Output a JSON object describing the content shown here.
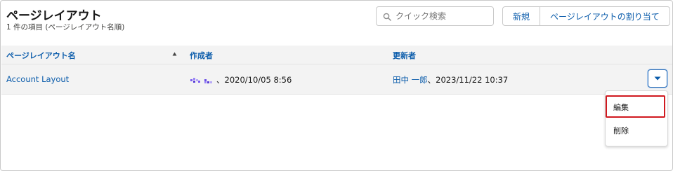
{
  "header": {
    "title": "ページレイアウト",
    "subtitle": "1 件の項目 (ページレイアウト名順)"
  },
  "search": {
    "placeholder": "クイック検索",
    "value": ""
  },
  "toolbar": {
    "new_label": "新規",
    "assign_label": "ページレイアウトの割り当て"
  },
  "table": {
    "columns": [
      {
        "label": "ページレイアウト名",
        "sorted": "ascending"
      },
      {
        "label": "作成者"
      },
      {
        "label": "更新者"
      }
    ],
    "rows": [
      {
        "name": "Account Layout",
        "created": "、2020/10/05 8:56",
        "modified_by": "田中 一郎",
        "modified_at": "、2023/11/22 10:37"
      }
    ]
  },
  "row_menu": {
    "items": [
      "編集",
      "削除"
    ],
    "highlighted": "編集"
  },
  "colors": {
    "accent": "#0b5cab",
    "header_bg": "#f3f3f3",
    "highlight": "#d0191f",
    "redaction": "#7b5cf0"
  },
  "icons": [
    "search-icon",
    "sort-ascending-icon",
    "chevron-down-icon"
  ]
}
